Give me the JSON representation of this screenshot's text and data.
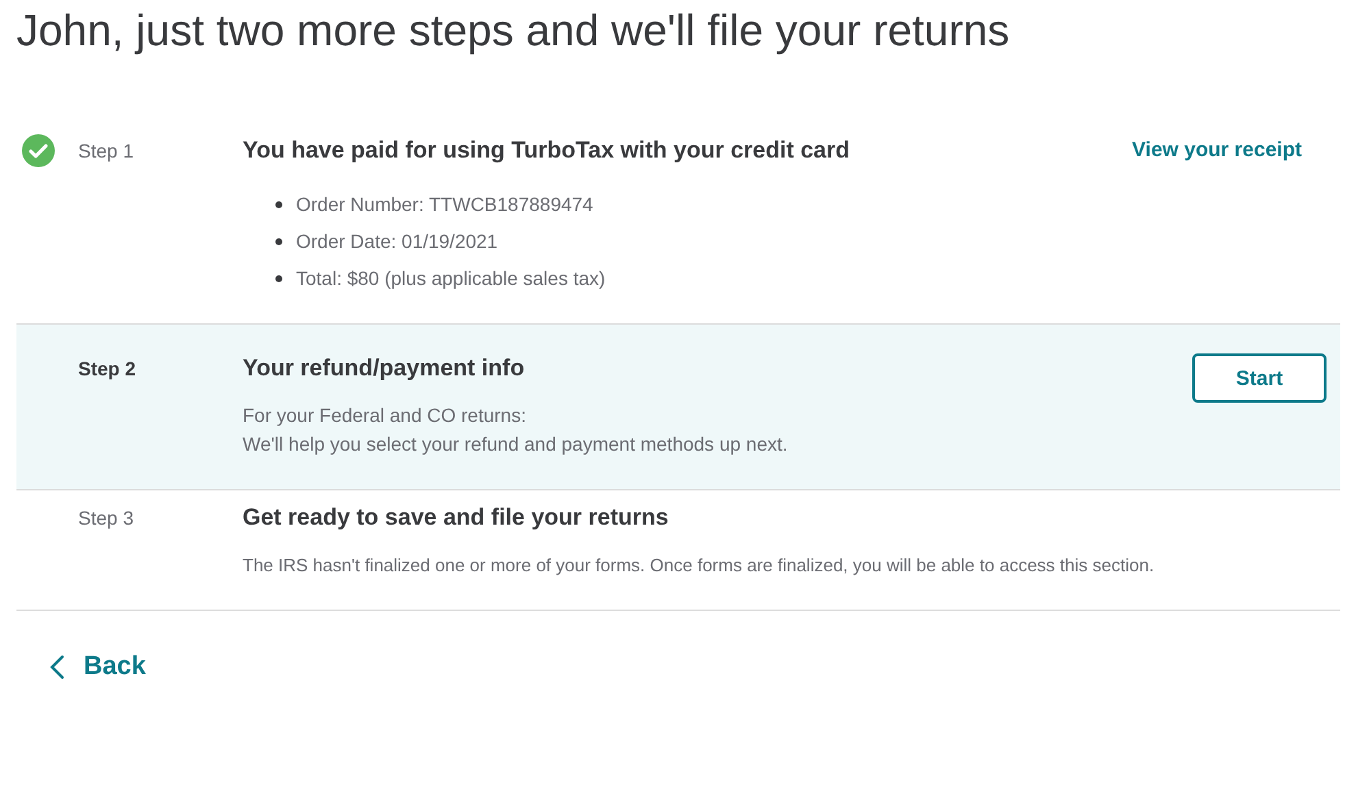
{
  "heading": "John, just two more steps and we'll file your returns",
  "steps": [
    {
      "label": "Step 1",
      "completed": true,
      "selected": false,
      "title": "You have paid for using TurboTax with your credit card",
      "action": {
        "kind": "link",
        "label": "View your receipt"
      },
      "bullets": [
        "Order Number: TTWCB187889474",
        "Order Date: 01/19/2021",
        "Total: $80 (plus applicable sales tax)"
      ]
    },
    {
      "label": "Step 2",
      "completed": false,
      "selected": true,
      "title": "Your refund/payment info",
      "action": {
        "kind": "button",
        "label": "Start"
      },
      "lines": [
        "For your Federal and CO returns:",
        "We'll help you select your refund and payment methods up next."
      ]
    },
    {
      "label": "Step 3",
      "completed": false,
      "selected": false,
      "title": "Get ready to save and file your returns",
      "lines": [
        "The IRS hasn't finalized one or more of your forms. Once forms are finalized, you will be able to access this section."
      ]
    }
  ],
  "back": "Back"
}
